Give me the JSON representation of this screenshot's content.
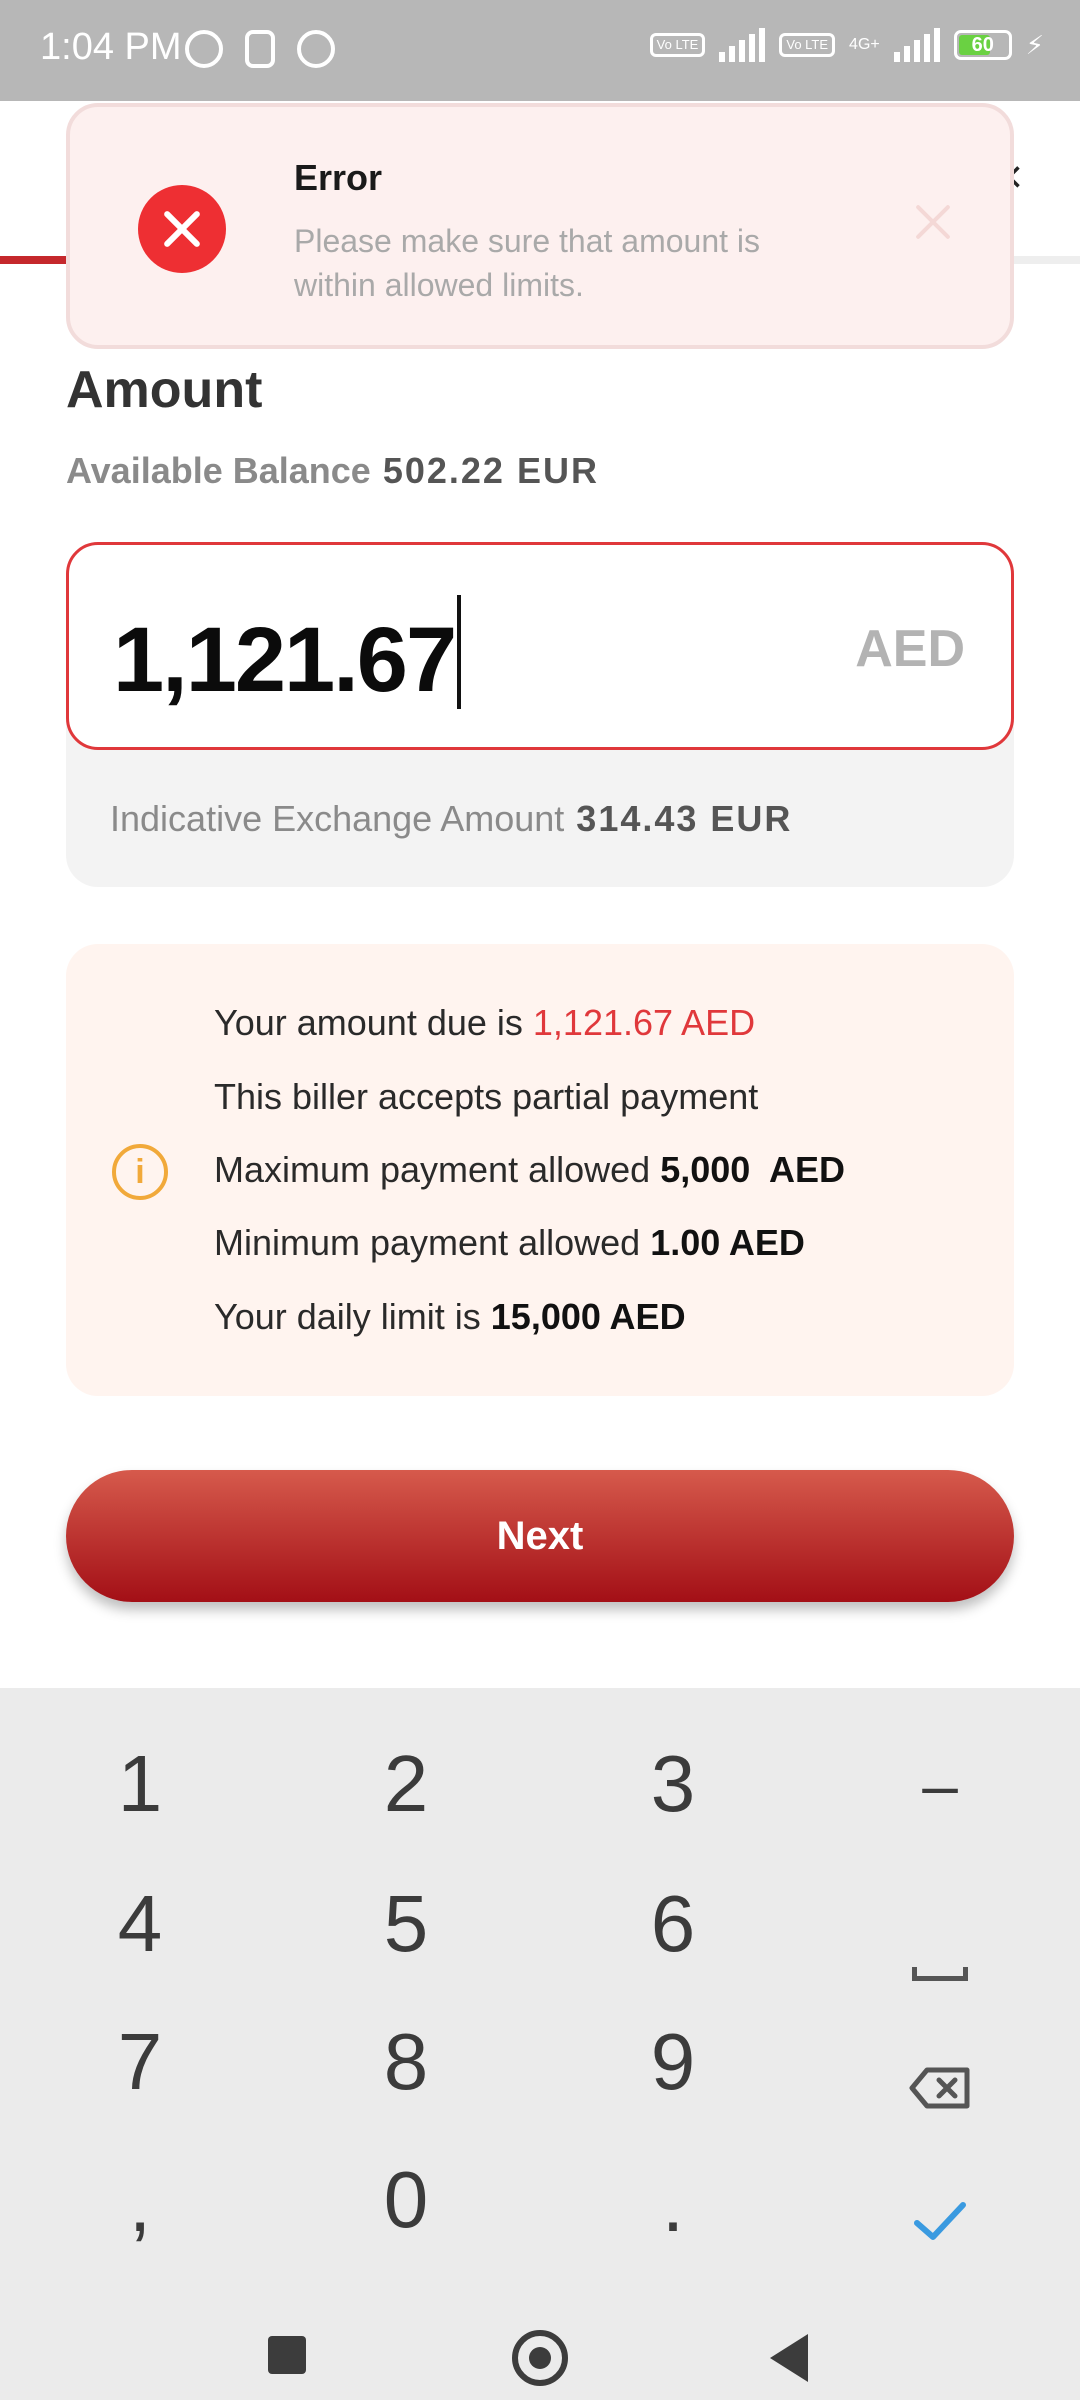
{
  "status_bar": {
    "time": "1:04 PM",
    "battery_level": "60",
    "network": "4G+",
    "volte_label": "Vo LTE"
  },
  "toast": {
    "title": "Error",
    "message": "Please make sure that amount is within allowed limits."
  },
  "amount": {
    "title": "Amount",
    "balance_label": "Available Balance",
    "balance_value": "502.22 EUR",
    "input_value": "1,121.67",
    "currency": "AED",
    "exchange_label": "Indicative Exchange Amount",
    "exchange_value": "314.43 EUR"
  },
  "info": {
    "line1_prefix": "Your amount due is",
    "line1_value": "1,121.67 AED",
    "line2": "This biller accepts partial payment",
    "line3_prefix": "Maximum payment allowed",
    "line3_value": "5,000  AED",
    "line4_prefix": "Minimum payment allowed",
    "line4_value": "1.00 AED",
    "line5_prefix": "Your daily limit is",
    "line5_value": "15,000 AED"
  },
  "next_button": {
    "label": "Next"
  },
  "keyboard": {
    "keys": [
      "1",
      "2",
      "3",
      "–",
      "4",
      "5",
      "6",
      "7",
      "8",
      "9",
      ",",
      "0",
      "."
    ]
  },
  "colors": {
    "accent_red": "#c5282c",
    "error_red": "#ee2f33",
    "warning_orange": "#f1a93a",
    "check_blue": "#3a9ae0"
  }
}
